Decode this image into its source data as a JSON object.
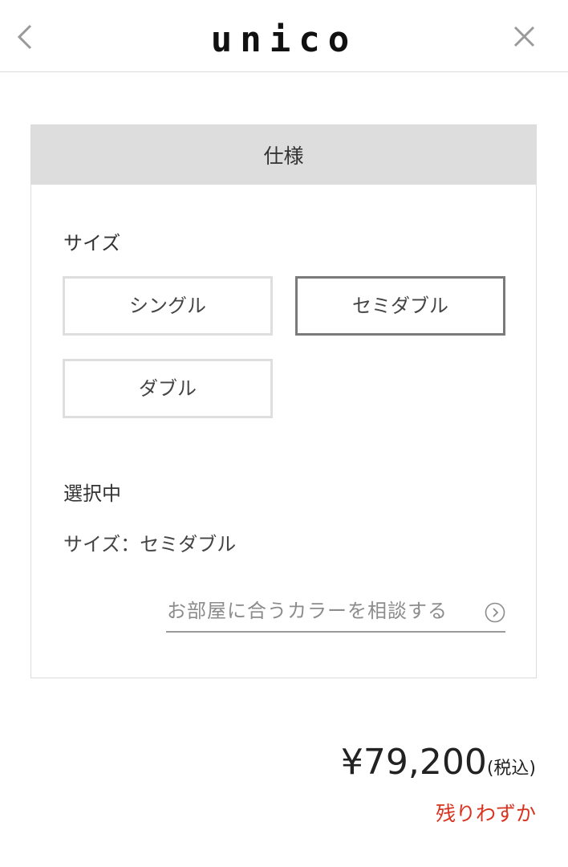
{
  "header": {
    "logo": "unico",
    "back_icon": "chevron-left-icon",
    "close_icon": "close-icon"
  },
  "spec": {
    "title": "仕様",
    "size_label": "サイズ",
    "options": [
      {
        "label": "シングル",
        "selected": false
      },
      {
        "label": "セミダブル",
        "selected": true
      },
      {
        "label": "ダブル",
        "selected": false
      }
    ],
    "selected_title": "選択中",
    "selected_value": "サイズ：セミダブル",
    "consult_link": "お部屋に合うカラーを相談する",
    "consult_icon": "circle-chevron-right-icon"
  },
  "price": {
    "amount": "¥79,200",
    "tax": "(税込)"
  },
  "stock": "残りわずか",
  "colors": {
    "header_bar": "#dddddd",
    "selected_border": "#7a7a7a",
    "unselected_border": "#dedede",
    "stock_red": "#d9331f",
    "link_gray": "#8c8c8c"
  }
}
